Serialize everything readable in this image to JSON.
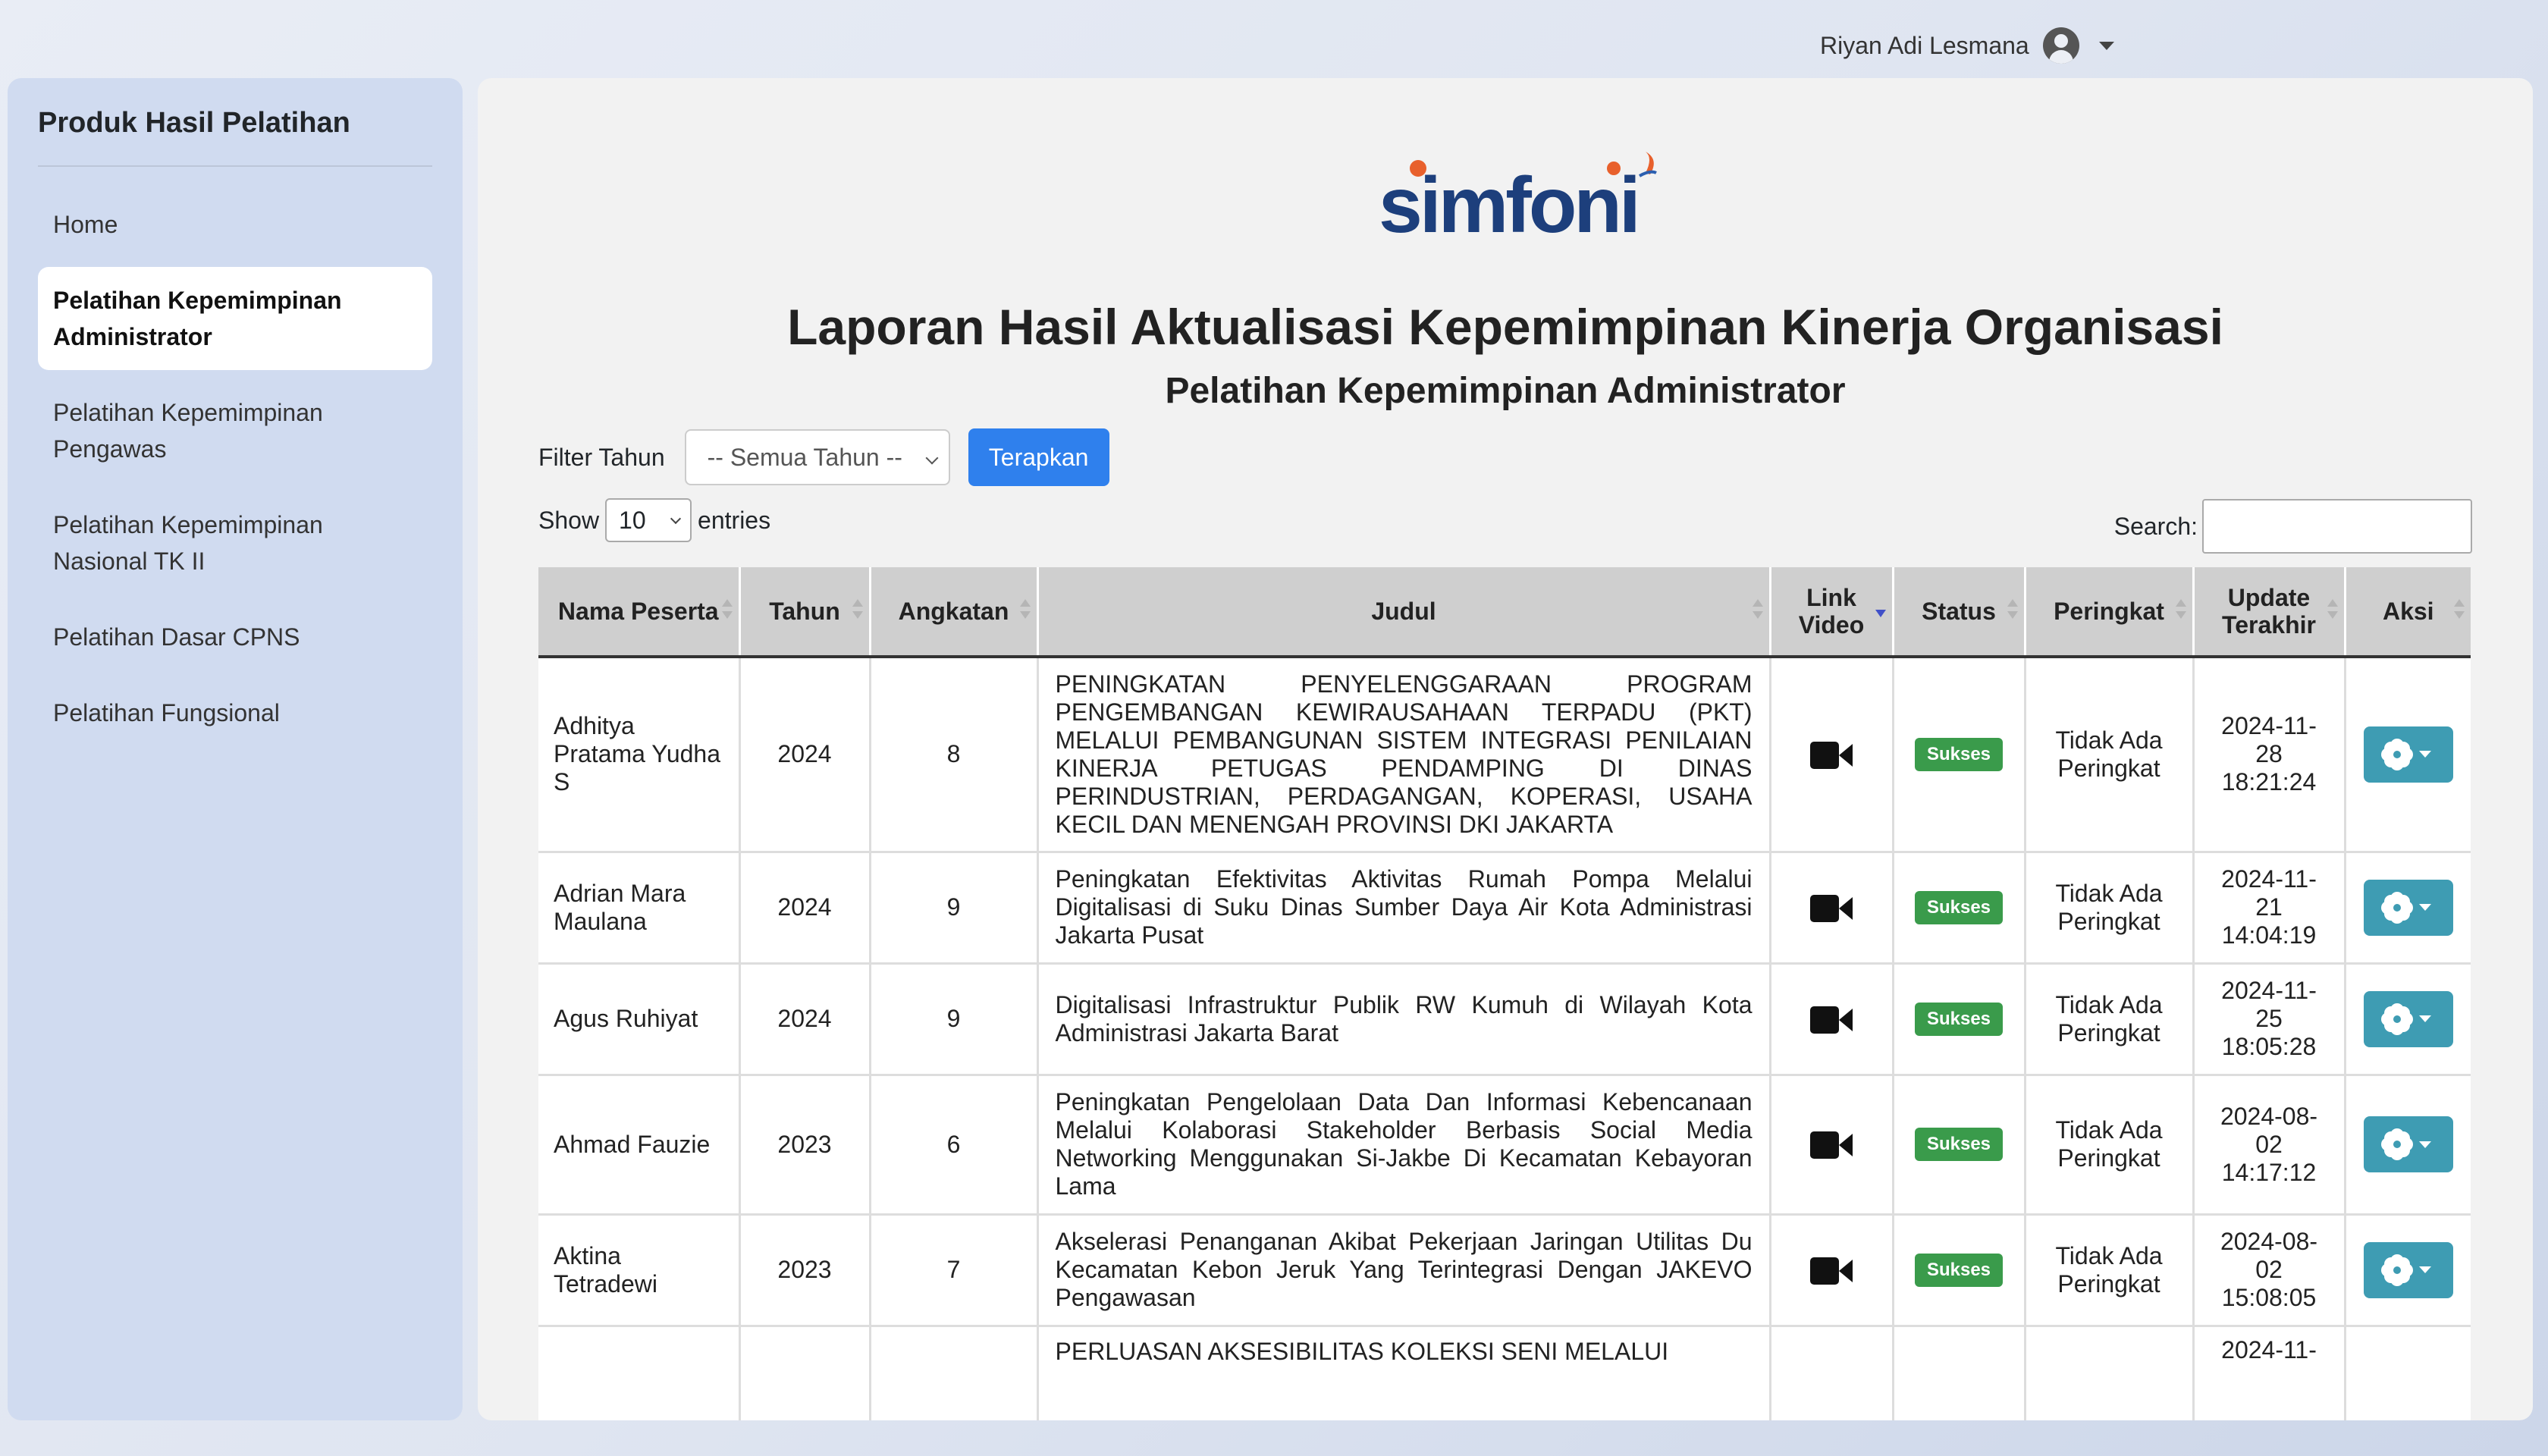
{
  "user": {
    "name": "Riyan Adi Lesmana"
  },
  "sidebar": {
    "title": "Produk Hasil Pelatihan",
    "items": [
      {
        "label": "Home",
        "active": false
      },
      {
        "label": "Pelatihan Kepemimpinan Administrator",
        "active": true
      },
      {
        "label": "Pelatihan Kepemimpinan Pengawas",
        "active": false
      },
      {
        "label": "Pelatihan Kepemimpinan Nasional TK II",
        "active": false
      },
      {
        "label": "Pelatihan Dasar CPNS",
        "active": false
      },
      {
        "label": "Pelatihan Fungsional",
        "active": false
      }
    ]
  },
  "main": {
    "logo_text": "simfoni",
    "title": "Laporan Hasil Aktualisasi Kepemimpinan Kinerja Organisasi",
    "subtitle": "Pelatihan Kepemimpinan Administrator",
    "filter": {
      "label": "Filter Tahun",
      "selected": "-- Semua Tahun --",
      "button": "Terapkan"
    },
    "show": {
      "prefix": "Show",
      "value": "10",
      "suffix": "entries"
    },
    "search": {
      "label": "Search:",
      "value": ""
    },
    "table": {
      "columns": [
        "Nama Peserta",
        "Tahun",
        "Angkatan",
        "Judul",
        "Link Video",
        "Status",
        "Peringkat",
        "Update Terakhir",
        "Aksi"
      ],
      "rows": [
        {
          "nama": "Adhitya Pratama Yudha S",
          "tahun": "2024",
          "angkatan": "8",
          "judul": "PENINGKATAN PENYELENGGARAAN PROGRAM PENGEMBANGAN KEWIRAUSAHAAN TERPADU (PKT) MELALUI PEMBANGUNAN SISTEM INTEGRASI PENILAIAN KINERJA PETUGAS PENDAMPING DI DINAS PERINDUSTRIAN, PERDAGANGAN, KOPERASI, USAHA KECIL DAN MENENGAH PROVINSI DKI JAKARTA",
          "status": "Sukses",
          "peringkat": "Tidak Ada Peringkat",
          "update": "2024-11-28 18:21:24"
        },
        {
          "nama": "Adrian Mara Maulana",
          "tahun": "2024",
          "angkatan": "9",
          "judul": "Peningkatan Efektivitas Aktivitas Rumah Pompa Melalui Digitalisasi di Suku Dinas Sumber Daya Air Kota Administrasi Jakarta Pusat",
          "status": "Sukses",
          "peringkat": "Tidak Ada Peringkat",
          "update": "2024-11-21 14:04:19"
        },
        {
          "nama": "Agus Ruhiyat",
          "tahun": "2024",
          "angkatan": "9",
          "judul": "Digitalisasi Infrastruktur Publik RW Kumuh di Wilayah Kota Administrasi Jakarta Barat",
          "status": "Sukses",
          "peringkat": "Tidak Ada Peringkat",
          "update": "2024-11-25 18:05:28"
        },
        {
          "nama": "Ahmad Fauzie",
          "tahun": "2023",
          "angkatan": "6",
          "judul": "Peningkatan Pengelolaan Data Dan Informasi Kebencanaan Melalui Kolaborasi Stakeholder Berbasis Social Media Networking Menggunakan Si-Jakbe Di Kecamatan Kebayoran Lama",
          "status": "Sukses",
          "peringkat": "Tidak Ada Peringkat",
          "update": "2024-08-02 14:17:12"
        },
        {
          "nama": "Aktina Tetradewi",
          "tahun": "2023",
          "angkatan": "7",
          "judul": "Akselerasi Penanganan Akibat Pekerjaan Jaringan Utilitas Du Kecamatan Kebon Jeruk Yang Terintegrasi Dengan JAKEVO Pengawasan",
          "status": "Sukses",
          "peringkat": "Tidak Ada Peringkat",
          "update": "2024-08-02 15:08:05"
        },
        {
          "nama": "",
          "tahun": "",
          "angkatan": "",
          "judul": "PERLUASAN AKSESIBILITAS KOLEKSI SENI MELALUI",
          "status": "",
          "peringkat": "",
          "update": "2024-11-"
        }
      ]
    }
  },
  "colors": {
    "primary_button": "#2f80ed",
    "status_success": "#3a9b4b",
    "action_button": "#3e9cb3"
  },
  "icons": {
    "user": "user-circle-icon",
    "video": "video-camera-icon",
    "action": "gear-icon"
  }
}
